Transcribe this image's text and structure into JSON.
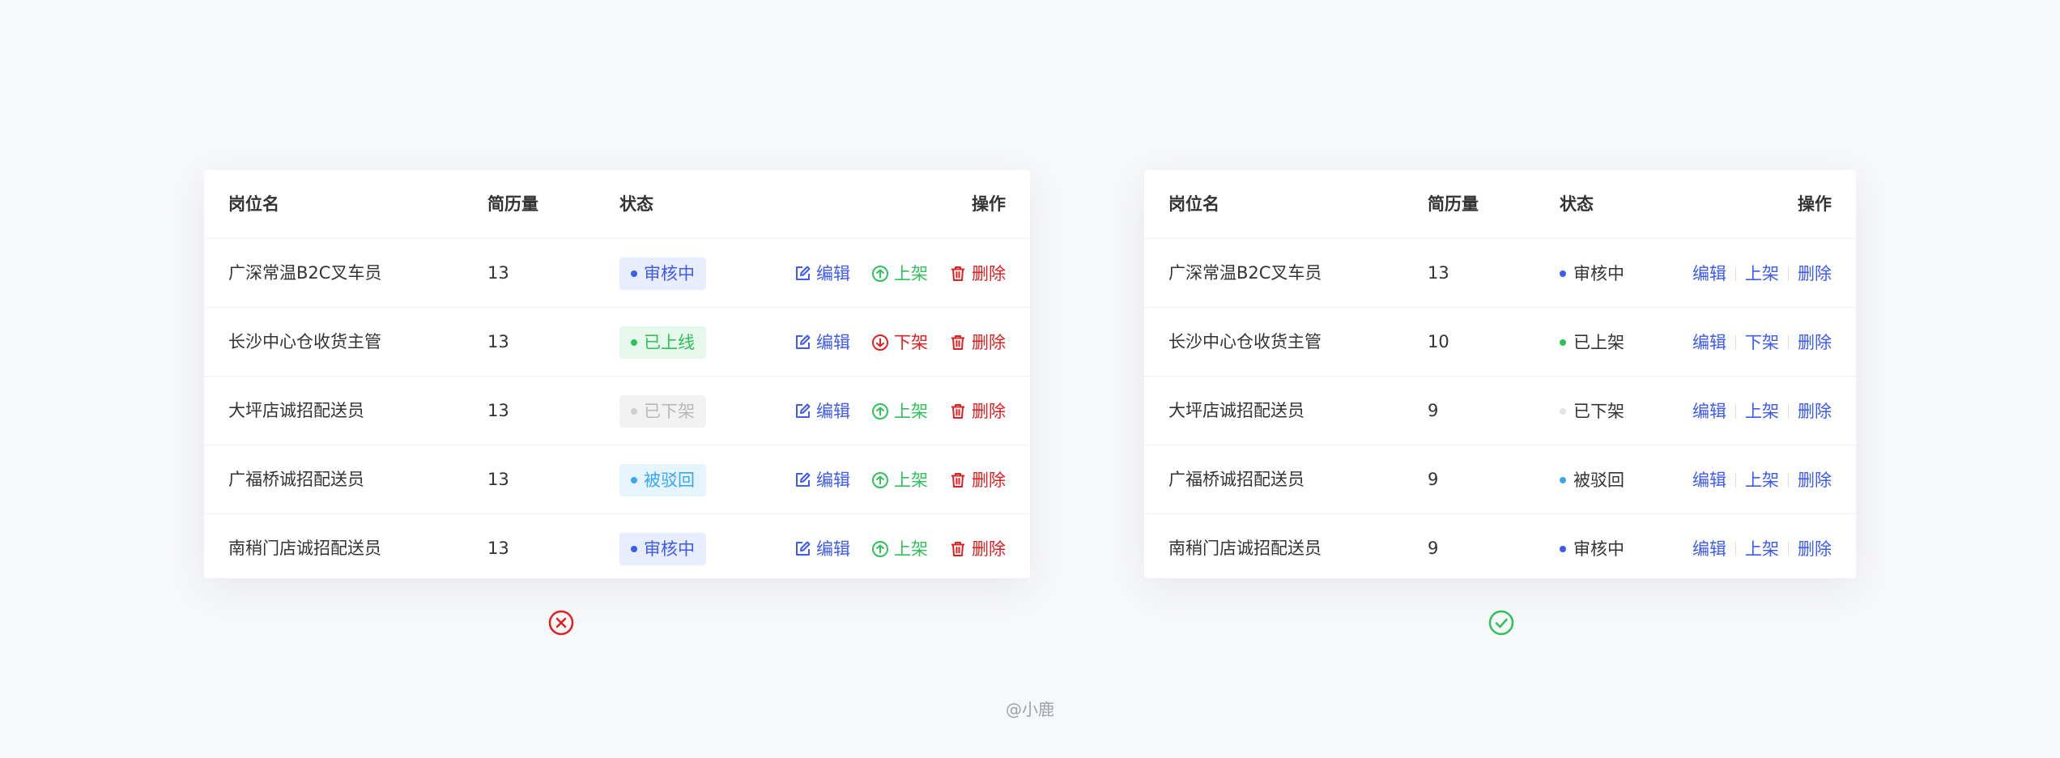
{
  "columns": {
    "name": "岗位名",
    "count": "简历量",
    "status": "状态",
    "ops": "操作"
  },
  "bad_table": {
    "rows": [
      {
        "name": "广深常温B2C叉车员",
        "count": "13",
        "status": "审核中",
        "status_kind": "review",
        "publish_label": "上架",
        "publish_kind": "up"
      },
      {
        "name": "长沙中心仓收货主管",
        "count": "13",
        "status": "已上线",
        "status_kind": "online",
        "publish_label": "下架",
        "publish_kind": "down"
      },
      {
        "name": "大坪店诚招配送员",
        "count": "13",
        "status": "已下架",
        "status_kind": "offline",
        "publish_label": "上架",
        "publish_kind": "up"
      },
      {
        "name": "广福桥诚招配送员",
        "count": "13",
        "status": "被驳回",
        "status_kind": "rejected",
        "publish_label": "上架",
        "publish_kind": "up"
      },
      {
        "name": "南稍门店诚招配送员",
        "count": "13",
        "status": "审核中",
        "status_kind": "review",
        "publish_label": "上架",
        "publish_kind": "up"
      }
    ],
    "edit_label": "编辑",
    "delete_label": "删除"
  },
  "good_table": {
    "rows": [
      {
        "name": "广深常温B2C叉车员",
        "count": "13",
        "status": "审核中",
        "status_kind": "review",
        "publish_label": "上架"
      },
      {
        "name": "长沙中心仓收货主管",
        "count": "10",
        "status": "已上架",
        "status_kind": "online",
        "publish_label": "下架"
      },
      {
        "name": "大坪店诚招配送员",
        "count": "9",
        "status": "已下架",
        "status_kind": "offline",
        "publish_label": "上架"
      },
      {
        "name": "广福桥诚招配送员",
        "count": "9",
        "status": "被驳回",
        "status_kind": "rejected",
        "publish_label": "上架"
      },
      {
        "name": "南稍门店诚招配送员",
        "count": "9",
        "status": "审核中",
        "status_kind": "review",
        "publish_label": "上架"
      }
    ],
    "edit_label": "编辑",
    "delete_label": "删除"
  },
  "verdicts": {
    "bad": "cross-circle-icon",
    "good": "check-circle-icon"
  },
  "credit": "@小鹿",
  "colors": {
    "primary": "#3d5af1",
    "success": "#2fc25b",
    "danger": "#e02020",
    "review_bg": "#e8edff",
    "online_bg": "#e6f7ec",
    "offline_bg": "#f2f2f2",
    "offline_fg": "#b8b8b8",
    "rejected_fg": "#3aa7f0",
    "rejected_bg": "#e5f4fd"
  }
}
